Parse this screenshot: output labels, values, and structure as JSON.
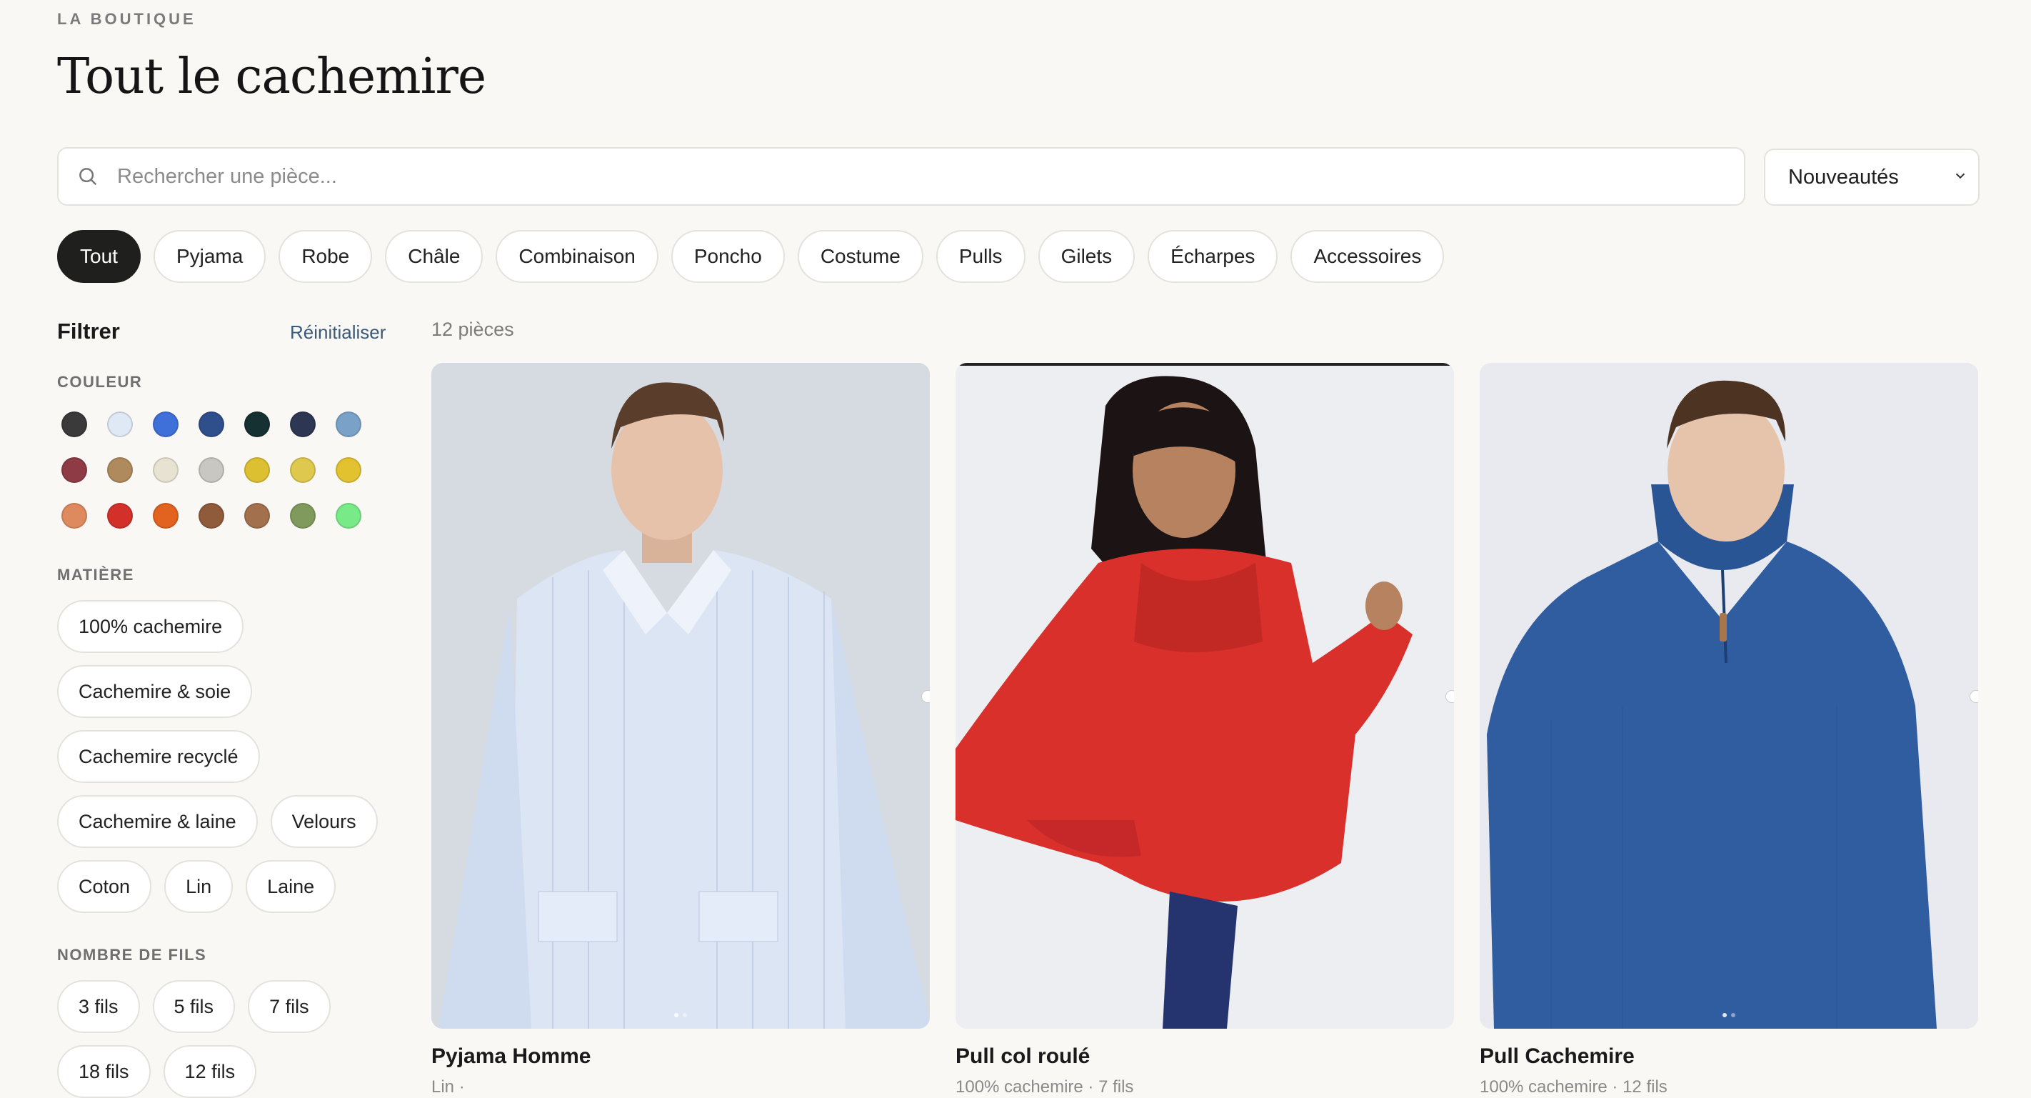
{
  "header": {
    "eyebrow": "LA BOUTIQUE",
    "title": "Tout le cachemire"
  },
  "search": {
    "placeholder": "Rechercher une pièce...",
    "value": ""
  },
  "sort": {
    "selected": "Nouveautés"
  },
  "categories": [
    {
      "label": "Tout",
      "active": true
    },
    {
      "label": "Pyjama"
    },
    {
      "label": "Robe"
    },
    {
      "label": "Châle"
    },
    {
      "label": "Combinaison"
    },
    {
      "label": "Poncho"
    },
    {
      "label": "Costume"
    },
    {
      "label": "Pulls"
    },
    {
      "label": "Gilets"
    },
    {
      "label": "Écharpes"
    },
    {
      "label": "Accessoires"
    }
  ],
  "filters": {
    "title": "Filtrer",
    "reset_label": "Réinitialiser",
    "color_heading": "COULEUR",
    "colors": [
      "#3a3a3a",
      "#dfe8f5",
      "#3f6fd9",
      "#2f4f8c",
      "#163131",
      "#2d3653",
      "#7aa2c8",
      "#8e3b45",
      "#ae8a5d",
      "#e8e2d2",
      "#c9c7c2",
      "#ddbf32",
      "#dfc84e",
      "#e3c230",
      "#df8a5e",
      "#d3302a",
      "#e2631f",
      "#8f5b3b",
      "#a3704d",
      "#7f9a5c",
      "#79ea88"
    ],
    "material_heading": "MATIÈRE",
    "materials": [
      "100% cachemire",
      "Cachemire & soie",
      "Cachemire recyclé",
      "Cachemire & laine",
      "Velours",
      "Coton",
      "Lin",
      "Laine"
    ],
    "threads_heading": "NOMBRE DE FILS",
    "threads": [
      "3 fils",
      "5 fils",
      "7 fils",
      "18 fils",
      "12 fils"
    ]
  },
  "results": {
    "count_label": "12 pièces"
  },
  "products": [
    {
      "name": "Pyjama Homme",
      "details": "Lin ·",
      "image": "man-striped-shirt"
    },
    {
      "name": "Pull col roulé",
      "details": "100% cachemire · 7 fils",
      "image": "girl-red-poncho"
    },
    {
      "name": "Pull Cachemire",
      "details": "100% cachemire · 12 fils",
      "image": "man-blue-sweater"
    }
  ]
}
